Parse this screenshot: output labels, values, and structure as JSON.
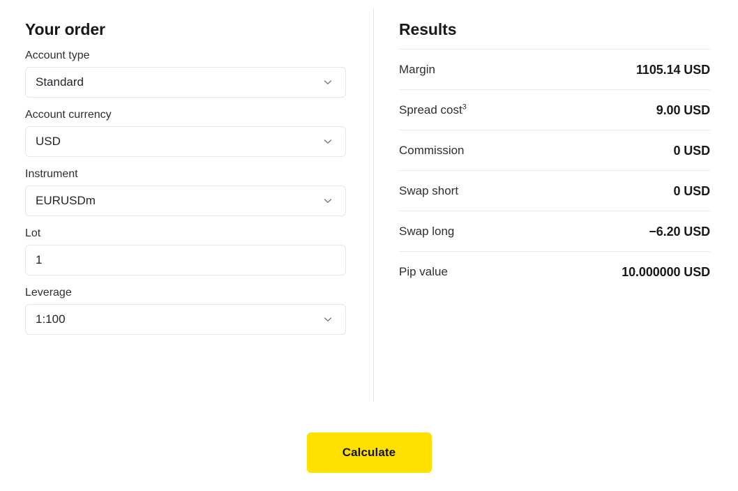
{
  "order": {
    "title": "Your order",
    "fields": [
      {
        "label": "Account type",
        "value": "Standard",
        "type": "select",
        "name": "account-type",
        "icon": "chevron-down-icon"
      },
      {
        "label": "Account currency",
        "value": "USD",
        "type": "select",
        "name": "account-currency",
        "icon": "chevron-down-icon"
      },
      {
        "label": "Instrument",
        "value": "EURUSDm",
        "type": "select",
        "name": "instrument",
        "icon": "chevron-down-icon"
      },
      {
        "label": "Lot",
        "value": "1",
        "type": "text",
        "name": "lot",
        "icon": ""
      },
      {
        "label": "Leverage",
        "value": "1:100",
        "type": "select",
        "name": "leverage",
        "icon": "chevron-down-icon"
      }
    ]
  },
  "results": {
    "title": "Results",
    "rows": [
      {
        "label": "Margin",
        "superscript": "",
        "value": "1105.14 USD"
      },
      {
        "label": "Spread cost",
        "superscript": "3",
        "value": "9.00 USD"
      },
      {
        "label": "Commission",
        "superscript": "",
        "value": "0 USD"
      },
      {
        "label": "Swap short",
        "superscript": "",
        "value": "0 USD"
      },
      {
        "label": "Swap long",
        "superscript": "",
        "value": "−6.20 USD"
      },
      {
        "label": "Pip value",
        "superscript": "",
        "value": "10.000000 USD"
      }
    ]
  },
  "actions": {
    "calculate_label": "Calculate"
  },
  "colors": {
    "accent": "#ffe100",
    "text": "#16181c",
    "border": "#e4e5e7",
    "divider": "#e9eaec"
  }
}
